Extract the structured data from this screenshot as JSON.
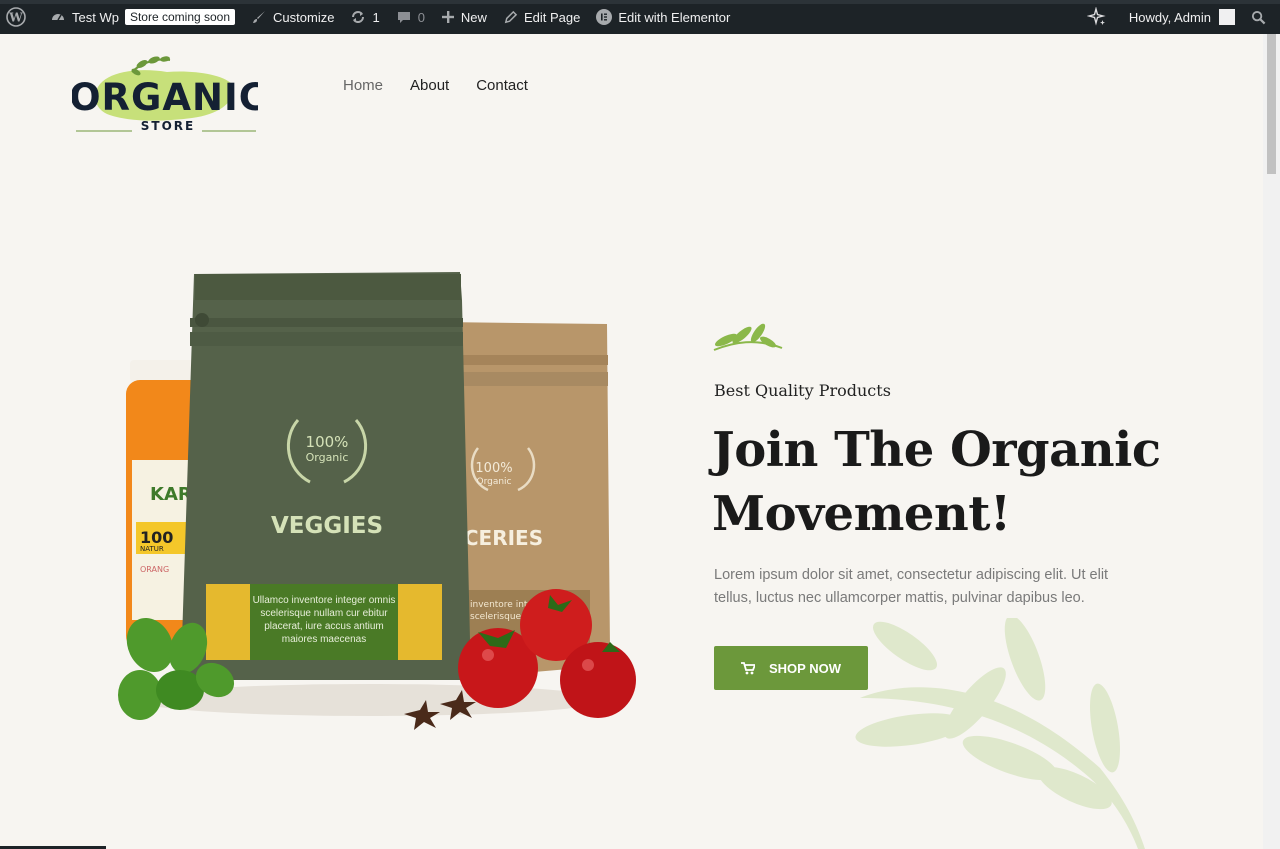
{
  "adminbar": {
    "site_name": "Test Wp",
    "coming_soon": "Store coming soon",
    "customize": "Customize",
    "updates_count": "1",
    "comments_count": "0",
    "new_label": "New",
    "edit_page": "Edit Page",
    "edit_elementor": "Edit with Elementor",
    "howdy": "Howdy, Admin"
  },
  "logo": {
    "word": "ORGANIC",
    "sub": "STORE"
  },
  "nav": {
    "items": [
      "Home",
      "About",
      "Contact"
    ]
  },
  "hero": {
    "eyebrow": "Best Quality Products",
    "title": "Join The Organic Movement!",
    "description": "Lorem ipsum dolor sit amet, consectetur adipiscing elit. Ut elit tellus, luctus nec ullamcorper mattis, pulvinar dapibus leo.",
    "button": "SHOP NOW"
  },
  "product": {
    "bag1_percent": "100%",
    "bag1_organic": "Organic",
    "bag1_name": "VEGGIES",
    "bag1_label": "Ullamco inventore integer omnis scelerisque nullam cur ebitur placerat, iure accus antium maiores maecenas",
    "bag2_percent": "100%",
    "bag2_organic": "Organic",
    "bag2_name": "OCERIES",
    "bag2_label_line1": "inventore integer",
    "bag2_label_line2": "scelerisque null",
    "jar_brand": "KAR",
    "jar_pct": "100",
    "jar_natural": "NATUR",
    "jar_orange": "ORANG"
  },
  "colors": {
    "accent": "#6c983b",
    "adminbar": "#1d2327",
    "bag_green": "#4f5d43",
    "bag_kraft": "#b8966a"
  }
}
